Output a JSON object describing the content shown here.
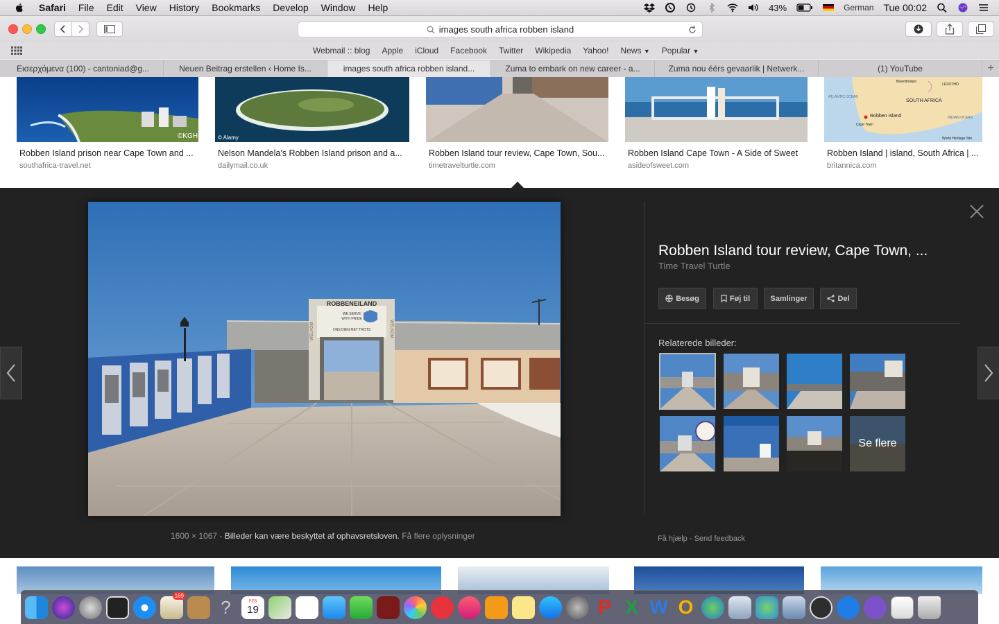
{
  "menubar": {
    "app": "Safari",
    "items": [
      "File",
      "Edit",
      "View",
      "History",
      "Bookmarks",
      "Develop",
      "Window",
      "Help"
    ],
    "battery": "43%",
    "input_source": "German",
    "clock": "Tue 00:02"
  },
  "toolbar": {
    "url": "images south africa robben island"
  },
  "favorites": [
    "Webmail :: blog",
    "Apple",
    "iCloud",
    "Facebook",
    "Twitter",
    "Wikipedia",
    "Yahoo!",
    "News",
    "Popular"
  ],
  "tabs": [
    "Εισερχόμενα (100) - cantoniad@g...",
    "Neuen Beitrag erstellen ‹ Home Is...",
    "images south africa robben island...",
    "Zuma to embark on new career - a...",
    "Zuma nou éérs gevaarlik | Netwerk...",
    "(1) YouTube"
  ],
  "results": [
    {
      "title": "Robben Island prison near Cape Town and ...",
      "source": "southafrica-travel.net",
      "watermark": "©KGH"
    },
    {
      "title": "Nelson Mandela's Robben Island prison and a...",
      "source": "dailymail.co.uk",
      "watermark": "© Alamy"
    },
    {
      "title": "Robben Island tour review, Cape Town, Sou...",
      "source": "timetravelturtle.com"
    },
    {
      "title": "Robben Island Cape Town - A Side of Sweet",
      "source": "asideofsweet.com"
    },
    {
      "title": "Robben Island | island, South Africa | ...",
      "source": "britannica.com"
    }
  ],
  "map_labels": {
    "a": "ATLANTIC OCEAN",
    "b": "SOUTH AFRICA",
    "c": "Robben Island",
    "d": "Cape Town",
    "e": "LESOTHO",
    "f": "INDIAN OCEAN",
    "g": "Bloemfontein",
    "h": "World Heritage Site"
  },
  "detail": {
    "title": "Robben Island tour review, Cape Town, ...",
    "source": "Time Travel Turtle",
    "buttons": {
      "visit": "Besøg",
      "add": "Føj til",
      "collections": "Samlinger",
      "share": "Del"
    },
    "related_label": "Relaterede billeder:",
    "see_more": "Se flere",
    "size": "1600 × 1067",
    "sep": "-",
    "copyright": "Billeder kan være beskyttet af ophavsretsloven.",
    "more_info": "Få flere oplysninger",
    "help": "Få hjælp",
    "feedback": "Send feedback",
    "sign_top": "ROBBENEILAND",
    "sign_line1": "WE SERVE",
    "sign_line2": "WITH PRIDE",
    "sign_line3": "ONS DIEN MET TROTS",
    "side_left": "WELKOM",
    "side_right": "WELKOM"
  },
  "dock": {
    "mail_badge": "169",
    "calendar_month": "FEB",
    "calendar_day": "19"
  },
  "colors": {
    "panel": "#222222",
    "sky": "#3f7fc0",
    "accent": "#3b82f6"
  }
}
